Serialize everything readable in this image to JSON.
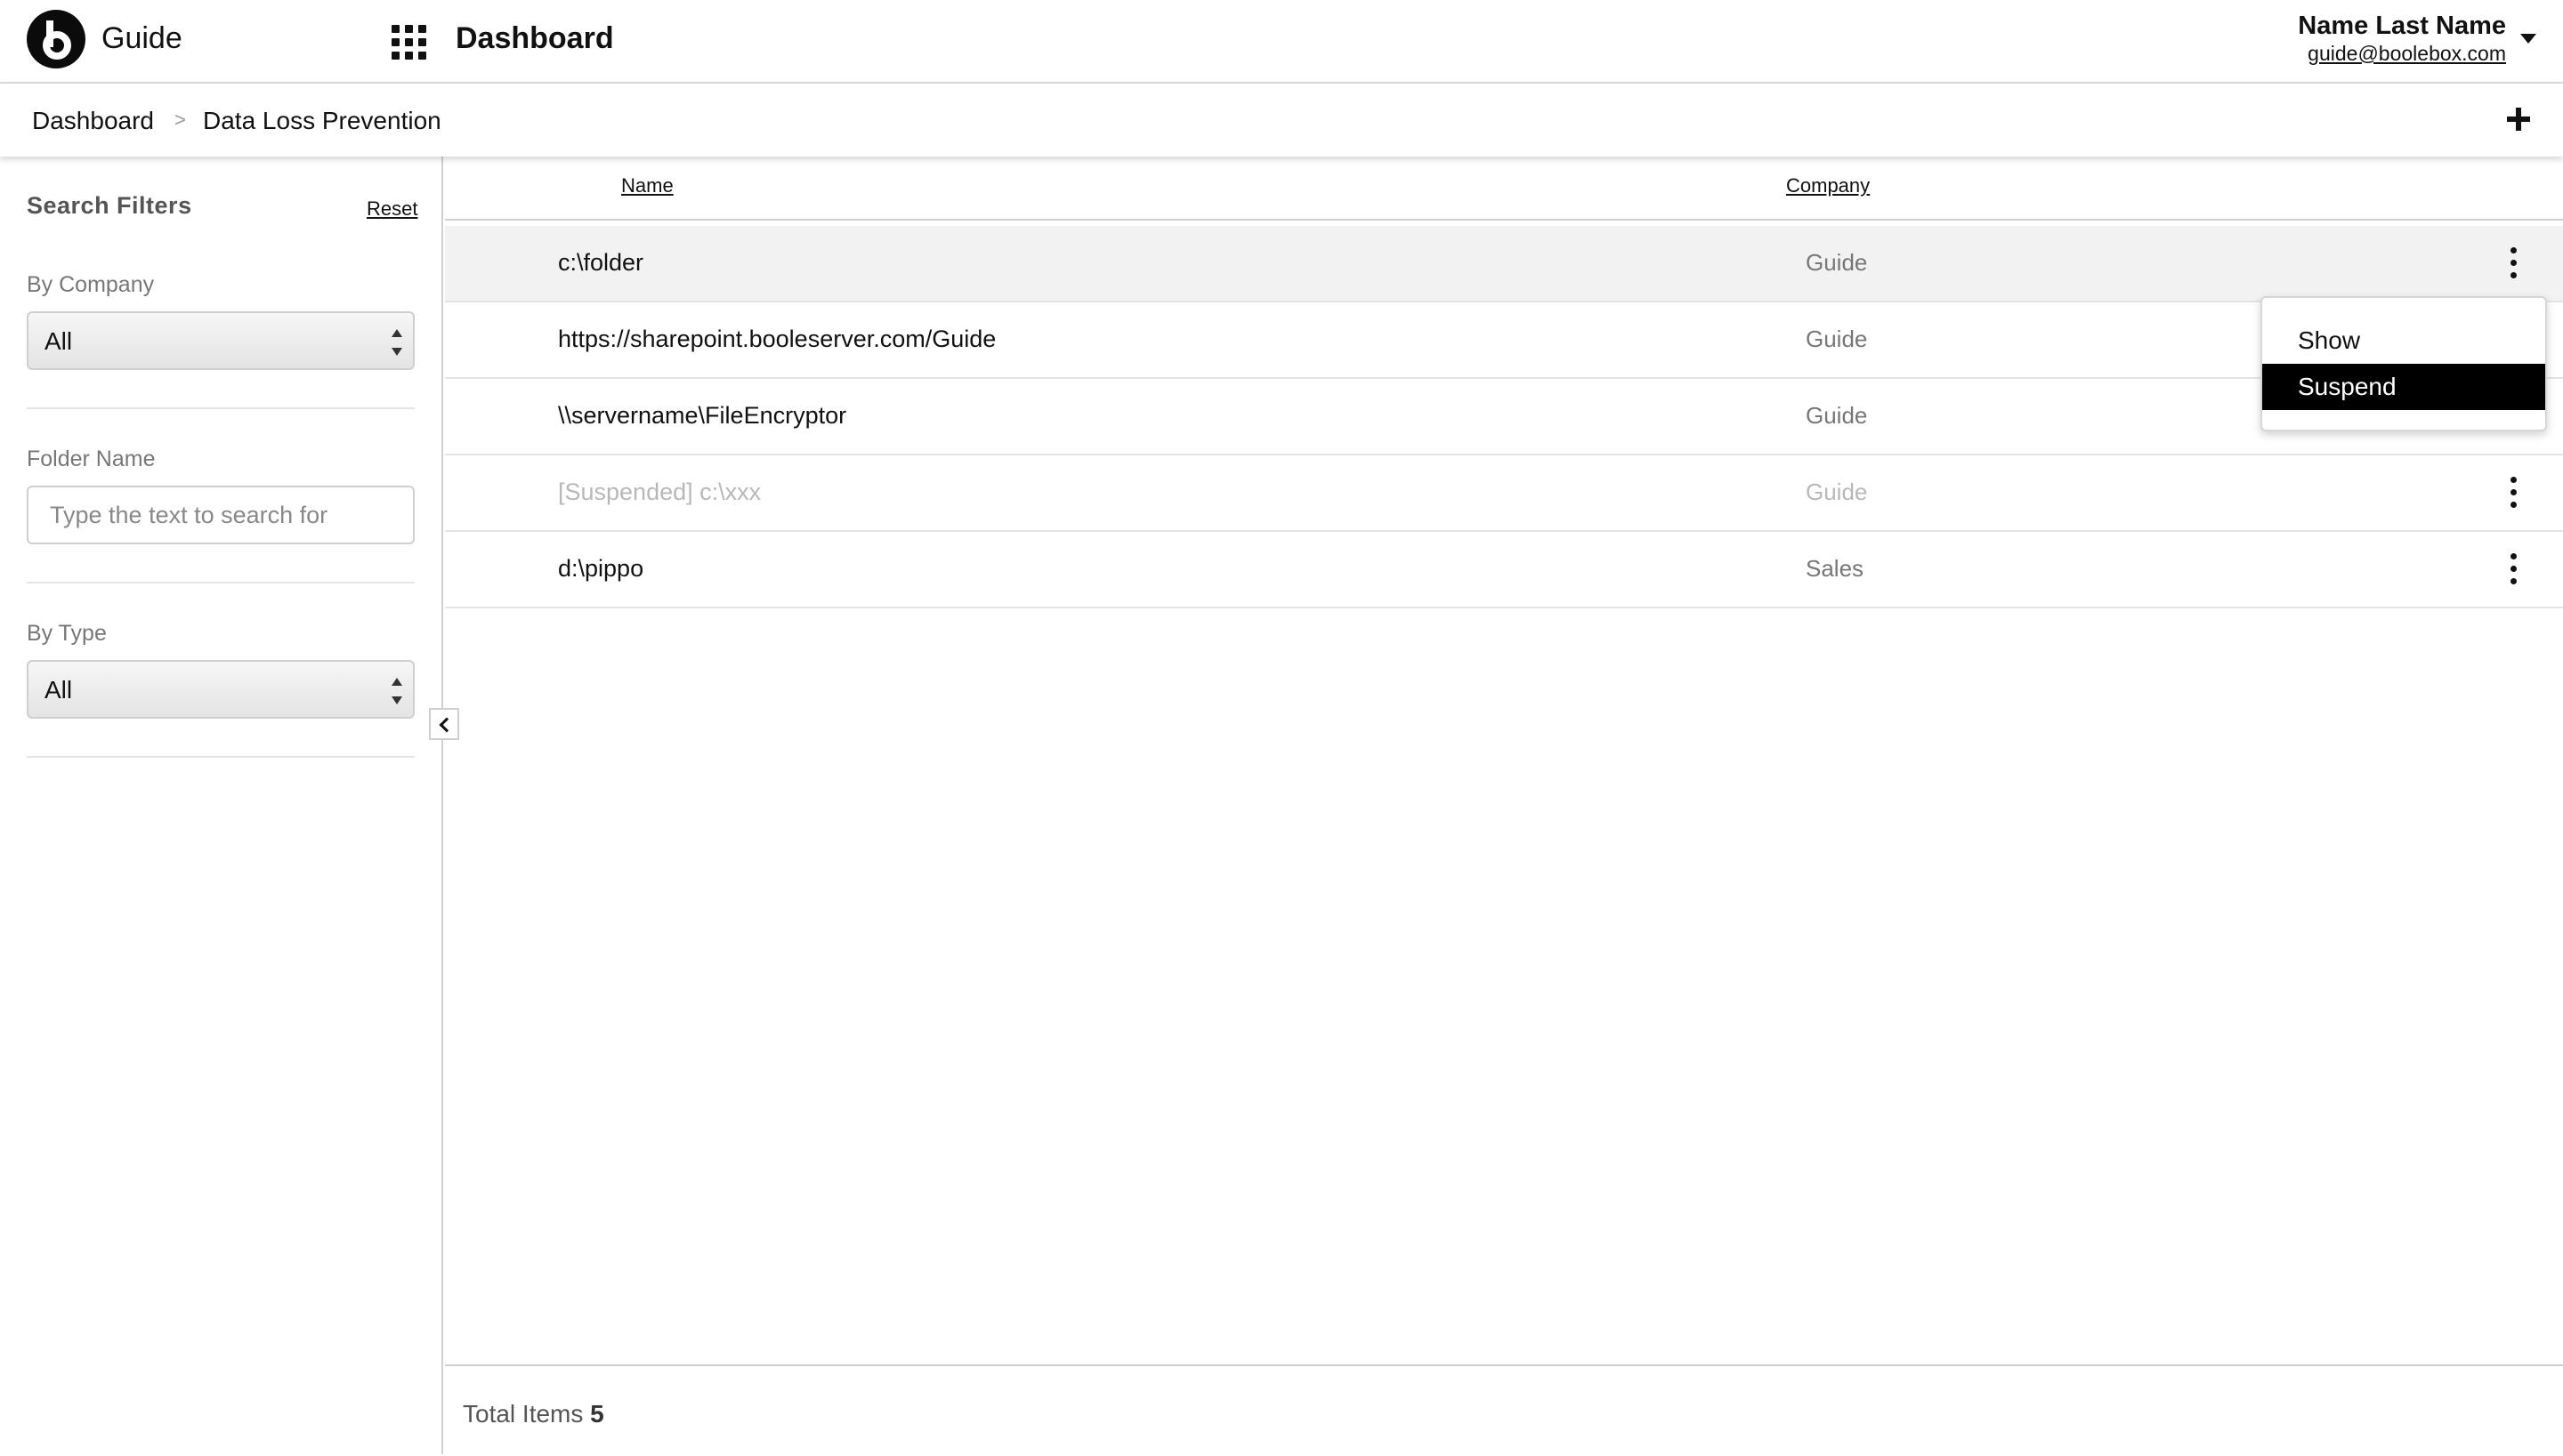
{
  "header": {
    "app_name": "Guide",
    "section_title": "Dashboard",
    "user": {
      "name": "Name Last Name",
      "email": "guide@boolebox.com"
    }
  },
  "breadcrumb": {
    "items": [
      "Dashboard",
      "Data Loss Prevention"
    ],
    "separator": ">"
  },
  "sidebar": {
    "title": "Search Filters",
    "reset_label": "Reset",
    "company_filter": {
      "label": "By Company",
      "value": "All"
    },
    "folder_filter": {
      "label": "Folder Name",
      "placeholder": "Type the text to search for",
      "value": ""
    },
    "type_filter": {
      "label": "By Type",
      "value": "All"
    }
  },
  "table": {
    "columns": {
      "name": "Name",
      "company": "Company"
    },
    "rows": [
      {
        "name": "c:\\folder",
        "company": "Guide",
        "suspended": false
      },
      {
        "name": "https://sharepoint.booleserver.com/Guide",
        "company": "Guide",
        "suspended": false
      },
      {
        "name": "\\\\servername\\FileEncryptor",
        "company": "Guide",
        "suspended": false
      },
      {
        "name": "[Suspended] c:\\xxx",
        "company": "Guide",
        "suspended": true
      },
      {
        "name": "d:\\pippo",
        "company": "Sales",
        "suspended": false
      }
    ]
  },
  "context_menu": {
    "items": [
      "Show",
      "Suspend"
    ],
    "active": "Suspend"
  },
  "footer": {
    "total_label": "Total Items",
    "total_count": "5"
  },
  "colors": {
    "accent": "#000000",
    "row_highlight": "#f2f2f2",
    "muted_text": "#777777",
    "suspended_text": "#b8b8b8"
  },
  "icons": {
    "logo": "b-logo-icon",
    "apps": "grid-icon",
    "user_menu": "caret-down-icon",
    "add": "plus-icon",
    "collapse": "chevron-left-icon",
    "row_actions": "kebab-menu-icon",
    "select": "select-arrows-icon"
  }
}
